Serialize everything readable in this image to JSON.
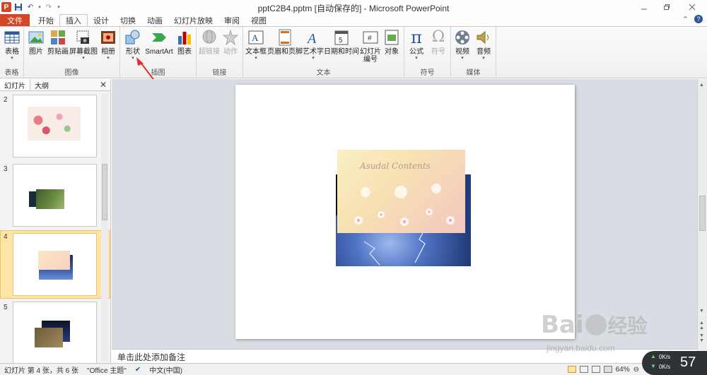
{
  "titlebar": {
    "title": "pptC2B4.pptm [自动保存的] - Microsoft PowerPoint",
    "app_logo": "P",
    "undo_glyph": "↶",
    "redo_glyph": "↷"
  },
  "tabs": [
    {
      "label": "文件"
    },
    {
      "label": "开始"
    },
    {
      "label": "插入"
    },
    {
      "label": "设计"
    },
    {
      "label": "切换"
    },
    {
      "label": "动画"
    },
    {
      "label": "幻灯片放映"
    },
    {
      "label": "审阅"
    },
    {
      "label": "视图"
    }
  ],
  "ribbon": {
    "groups": {
      "table": "表格",
      "image": "图像",
      "illustration": "插图",
      "link": "链接",
      "text": "文本",
      "symbol": "符号",
      "media": "媒体"
    },
    "buttons": {
      "table": "表格",
      "picture": "图片",
      "clipart": "剪贴画",
      "screenshot": "屏幕截图",
      "album": "相册",
      "shapes": "形状",
      "smartart": "SmartArt",
      "chart": "图表",
      "hyperlink": "超链接",
      "action": "动作",
      "textbox": "文本框",
      "header_footer": "页眉和页脚",
      "wordart": "艺术字",
      "datetime": "日期和时间",
      "slide_number_1": "幻灯片",
      "slide_number_2": "编号",
      "object": "对象",
      "equation": "公式",
      "symbol": "符号",
      "video": "视频",
      "audio": "音频"
    }
  },
  "left_pane": {
    "tab_slides": "幻灯片",
    "tab_outline": "大纲",
    "close": "✕",
    "slides": [
      {
        "num": "2"
      },
      {
        "num": "3"
      },
      {
        "num": "4"
      },
      {
        "num": "5"
      }
    ]
  },
  "slide_content": {
    "script_text": "Asudal Contents"
  },
  "notes": {
    "placeholder": "单击此处添加备注"
  },
  "status": {
    "slide_info": "幻灯片 第 4 张，共 6 张",
    "theme": "\"Office 主题\"",
    "language": "中文(中国)",
    "zoom": "64%",
    "zoom_minus": "⊖",
    "zoom_plus": "⊕"
  },
  "watermark": {
    "brand": "Bai",
    "brand_suffix": "经验",
    "url": "jingyan.baidu.com"
  },
  "net_widget": {
    "up": "0K/s",
    "down": "0K/s",
    "value": "57"
  },
  "colors": {
    "file_tab": "#d24726",
    "accent": "#2b579a",
    "selection": "#fde6a5",
    "arrow": "#e03030"
  }
}
